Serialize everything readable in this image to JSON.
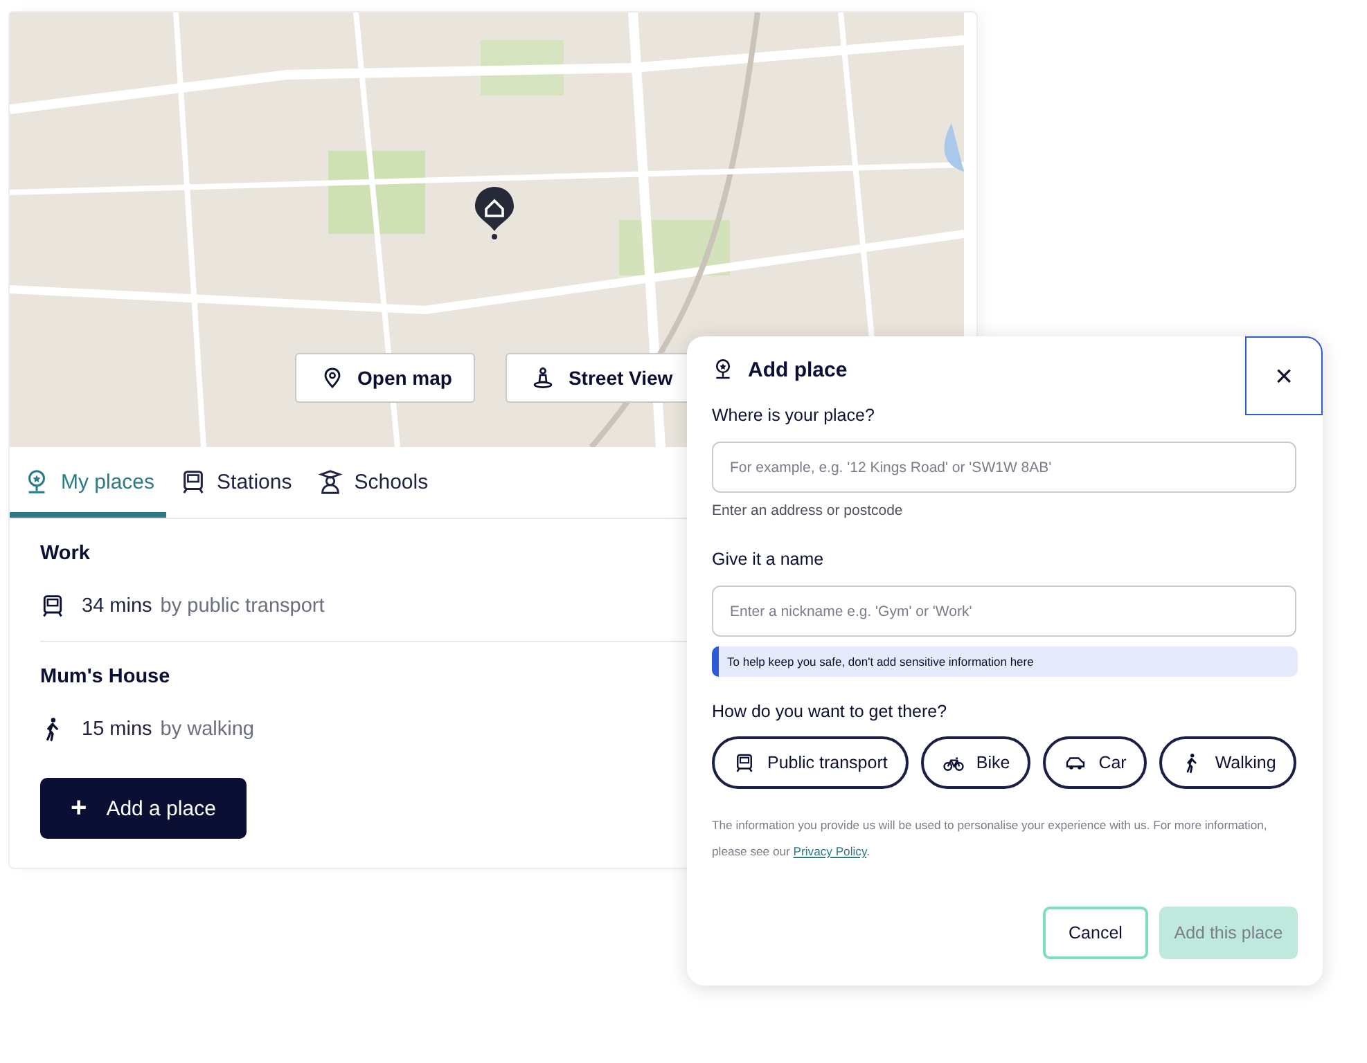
{
  "map": {
    "buttons": [
      {
        "label": "Open map",
        "kind": "pin"
      },
      {
        "label": "Street View",
        "kind": "person"
      }
    ]
  },
  "tabs": [
    {
      "label": "My places",
      "kind": "places",
      "selected": true
    },
    {
      "label": "Stations",
      "kind": "train",
      "selected": false
    },
    {
      "label": "Schools",
      "kind": "school",
      "selected": false
    }
  ],
  "places": [
    {
      "name": "Work",
      "kind": "train",
      "duration": "34 mins",
      "mode_text": "by public transport"
    },
    {
      "name": "Mum's House",
      "kind": "walk",
      "duration": "15 mins",
      "mode_text": "by walking"
    }
  ],
  "add_button": {
    "icon": "+",
    "label": "Add a place"
  },
  "dialog": {
    "title": "Add place",
    "close": "×",
    "address_label": "Where is your place?",
    "address_placeholder": "For example, e.g. '12 Kings Road' or 'SW1W 8AB'",
    "address_hint": "Enter an address or postcode",
    "name_label": "Give it a name",
    "name_placeholder": "Enter a nickname e.g. 'Gym' or 'Work'",
    "notice": "To help keep you safe, don't add sensitive information here",
    "modes_label": "How do you want to get there?",
    "modes": [
      {
        "label": "Public transport",
        "kind": "train",
        "selected": false
      },
      {
        "label": "Bike",
        "kind": "bike",
        "selected": false
      },
      {
        "label": "Car",
        "kind": "car",
        "selected": false
      },
      {
        "label": "Walking",
        "kind": "walk",
        "selected": false
      }
    ],
    "privacy_text": "The information you provide us will be used to personalise your experience with us. For more information, please see our",
    "privacy_link": "Privacy Policy",
    "privacy_end": ".",
    "cancel": "Cancel",
    "submit": {
      "label": "Add this place",
      "disabled": true
    }
  }
}
